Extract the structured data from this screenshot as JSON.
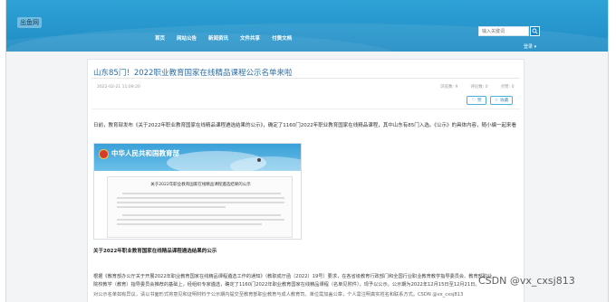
{
  "header": {
    "logo_text": "出鱼网",
    "nav": [
      "首页",
      "网站公告",
      "新闻资讯",
      "文件共享",
      "付费文档"
    ],
    "search_placeholder": "输入关键词",
    "login_label": "登录 ▾",
    "colors": {
      "header": "#1f8cc4",
      "accent": "#2a6ea8"
    }
  },
  "article": {
    "title": "山东85门！2022职业教育国家在线精品课程公示名单来啦",
    "date": "2022-02-21 11:09:20",
    "stats": [
      "浏览数: 9",
      "评论数: 0",
      "点赞: 0"
    ],
    "like_label": "赞",
    "fav_label": "收藏",
    "para1": "日前，教育部发布《关于2022年职业教育国家在线精品课程遴选结果的公示》，确定了1160门2022年职业教育国家在线精品课程，其中山东有85门入选。《公示》的具体内容，随小编一起来看",
    "para1_end": "看",
    "embed": {
      "ministry": "中华人民共和国教育部",
      "doc_title": "关于2022年职业教育国家在线精品课程遴选结果的公示"
    },
    "bold_heading": "关于2022年职业教育国家在线精品课程遴选结果的公示",
    "para2_lines": [
      "根据《教育部办公厅关于开展2022年职业教育国家在线精品课程遴选工作的通知》（教职成厅函〔2022〕19号）要求，在各省级教育行政部门和全国行业职业教育教学指导委员会、教育部职业",
      "院校教学（教育）指导委员会推荐的基础上，经组织专家遴选，确定了1160门2022年职业教育国家在线精品课程（名单见附件），现予以公示。公示期为2022年12月15日至12月21日。"
    ],
    "para3": "对公示名单如有异议，请以书面形式将意见和证明材料于公示期内提交至教育部职业教育与成人教育司。单位需加盖公章，个人需注明真实姓名和联系方式。CSDN @vx_cxsj813",
    "watermark": "CSDN @vx_cxsj813"
  }
}
